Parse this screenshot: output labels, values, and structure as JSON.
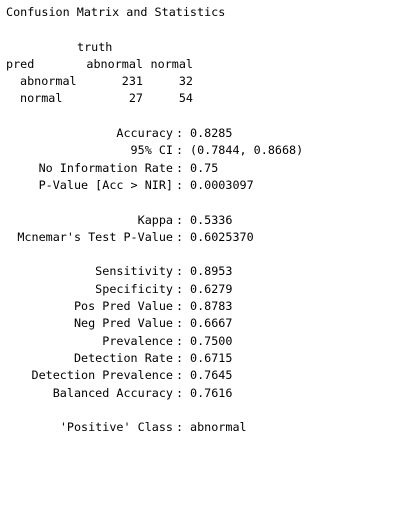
{
  "title": "Confusion Matrix and Statistics",
  "matrix": {
    "truth_label": "truth",
    "pred_label": "pred",
    "col_headers": [
      "abnormal",
      "normal"
    ],
    "rows": [
      {
        "label": "abnormal",
        "values": [
          "231",
          "32"
        ]
      },
      {
        "label": "normal",
        "values": [
          "27",
          "54"
        ]
      }
    ]
  },
  "separator": ":",
  "overall": [
    {
      "label": "Accuracy",
      "value": "0.8285"
    },
    {
      "label": "95% CI",
      "value": "(0.7844, 0.8668)"
    },
    {
      "label": "No Information Rate",
      "value": "0.75"
    },
    {
      "label": "P-Value [Acc > NIR]",
      "value": "0.0003097"
    }
  ],
  "kappa": [
    {
      "label": "Kappa",
      "value": "0.5336"
    },
    {
      "label": "Mcnemar's Test P-Value",
      "value": "0.6025370"
    }
  ],
  "class_stats": [
    {
      "label": "Sensitivity",
      "value": "0.8953"
    },
    {
      "label": "Specificity",
      "value": "0.6279"
    },
    {
      "label": "Pos Pred Value",
      "value": "0.8783"
    },
    {
      "label": "Neg Pred Value",
      "value": "0.6667"
    },
    {
      "label": "Prevalence",
      "value": "0.7500"
    },
    {
      "label": "Detection Rate",
      "value": "0.6715"
    },
    {
      "label": "Detection Prevalence",
      "value": "0.7645"
    },
    {
      "label": "Balanced Accuracy",
      "value": "0.7616"
    }
  ],
  "positive_class": {
    "label": "'Positive' Class",
    "value": "abnormal"
  }
}
